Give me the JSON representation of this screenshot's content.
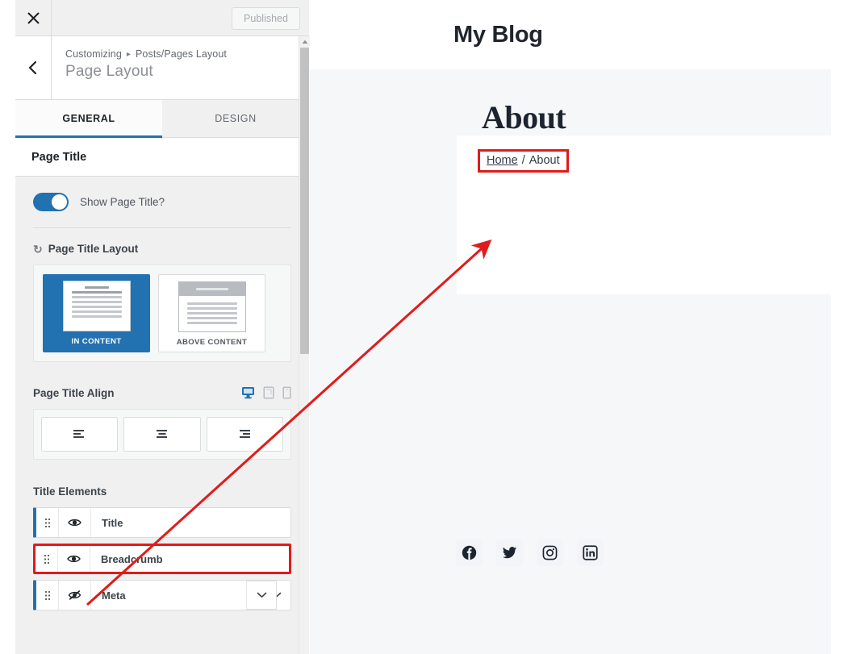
{
  "customizer": {
    "close_icon": "close-icon",
    "published_label": "Published",
    "back_icon": "chevron-left-icon",
    "breadcrumb": {
      "root": "Customizing",
      "separator": "▸",
      "current": "Posts/Pages Layout"
    },
    "panel_title": "Page Layout",
    "tabs": [
      {
        "label": "GENERAL",
        "active": true
      },
      {
        "label": "DESIGN",
        "active": false
      }
    ],
    "section_title": "Page Title",
    "show_page_title": {
      "label": "Show Page Title?",
      "value": true,
      "accent": "#2271b1"
    },
    "page_title_layout": {
      "label": "Page Title Layout",
      "reset_icon": "reset-icon",
      "options": [
        {
          "caption": "IN CONTENT",
          "selected": true
        },
        {
          "caption": "ABOVE CONTENT",
          "selected": false
        }
      ]
    },
    "page_title_align": {
      "label": "Page Title Align",
      "devices": [
        {
          "name": "desktop-icon",
          "active": true
        },
        {
          "name": "tablet-icon",
          "active": false
        },
        {
          "name": "mobile-icon",
          "active": false
        }
      ],
      "options": [
        {
          "name": "align-left-icon"
        },
        {
          "name": "align-center-icon"
        },
        {
          "name": "align-right-icon"
        }
      ]
    },
    "title_elements": {
      "label": "Title Elements",
      "items": [
        {
          "label": "Title",
          "visible": true,
          "has_chevron": false,
          "highlighted": false
        },
        {
          "label": "Breadcrumb",
          "visible": true,
          "has_chevron": true,
          "highlighted": true
        },
        {
          "label": "Meta",
          "visible": false,
          "has_chevron": true,
          "highlighted": false
        }
      ]
    }
  },
  "preview": {
    "site_title": "My Blog",
    "page_heading": "About",
    "breadcrumb": {
      "home_label": "Home",
      "separator": "/",
      "current_label": "About",
      "highlight_color": "#e11b1b"
    },
    "social_icons": [
      {
        "name": "facebook-icon"
      },
      {
        "name": "twitter-icon"
      },
      {
        "name": "instagram-icon"
      },
      {
        "name": "linkedin-icon"
      }
    ]
  },
  "annotation": {
    "arrow_color": "#e11b1b"
  }
}
